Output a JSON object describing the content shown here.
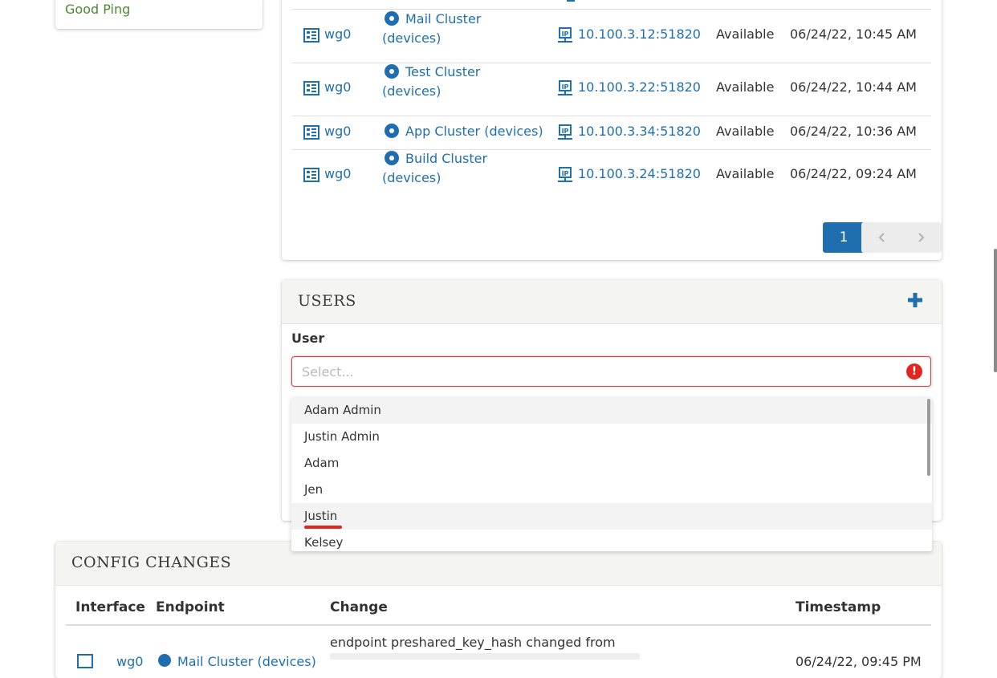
{
  "sidebar": {
    "good_ping": "Good Ping"
  },
  "devices": {
    "rows": [
      {
        "interface": "wg0",
        "endpoint_line1": "Mail Cluster",
        "endpoint_line2": "(devices)",
        "address": "10.100.3.12:51820",
        "status": "Available",
        "timestamp": "06/24/22, 10:45 AM"
      },
      {
        "interface": "wg0",
        "endpoint_line1": "Test Cluster",
        "endpoint_line2": "(devices)",
        "address": "10.100.3.22:51820",
        "status": "Available",
        "timestamp": "06/24/22, 10:44 AM"
      },
      {
        "interface": "wg0",
        "endpoint_line1": "App Cluster (devices)",
        "endpoint_line2": "",
        "address": "10.100.3.34:51820",
        "status": "Available",
        "timestamp": "06/24/22, 10:36 AM"
      },
      {
        "interface": "wg0",
        "endpoint_line1": "Build Cluster",
        "endpoint_line2": "(devices)",
        "address": "10.100.3.24:51820",
        "status": "Available",
        "timestamp": "06/24/22, 09:24 AM"
      }
    ],
    "pagination": {
      "current_page": "1",
      "prev_icon": "chevron-left-icon",
      "next_icon": "chevron-right-icon"
    }
  },
  "users": {
    "title": "USERS",
    "add_icon": "plus-icon",
    "field_label": "User",
    "select_placeholder": "Select...",
    "error_icon_glyph": "!",
    "options": [
      "Adam Admin",
      "Justin Admin",
      "Adam",
      "Jen",
      "Justin",
      "Kelsey"
    ]
  },
  "config_changes": {
    "title": "CONFIG CHANGES",
    "columns": {
      "interface": "Interface",
      "endpoint": "Endpoint",
      "change": "Change",
      "timestamp": "Timestamp"
    },
    "rows": [
      {
        "change": "endpoint preshared_key_hash changed from",
        "endpoint": "Mail Cluster (devices)",
        "interface": "wg0",
        "timestamp": "06/24/22, 09:45 PM"
      }
    ]
  },
  "colors": {
    "link": "#1f6fb0",
    "good": "#4b8b2b",
    "error": "#e0261f",
    "primary_button": "#1f6fb0"
  }
}
